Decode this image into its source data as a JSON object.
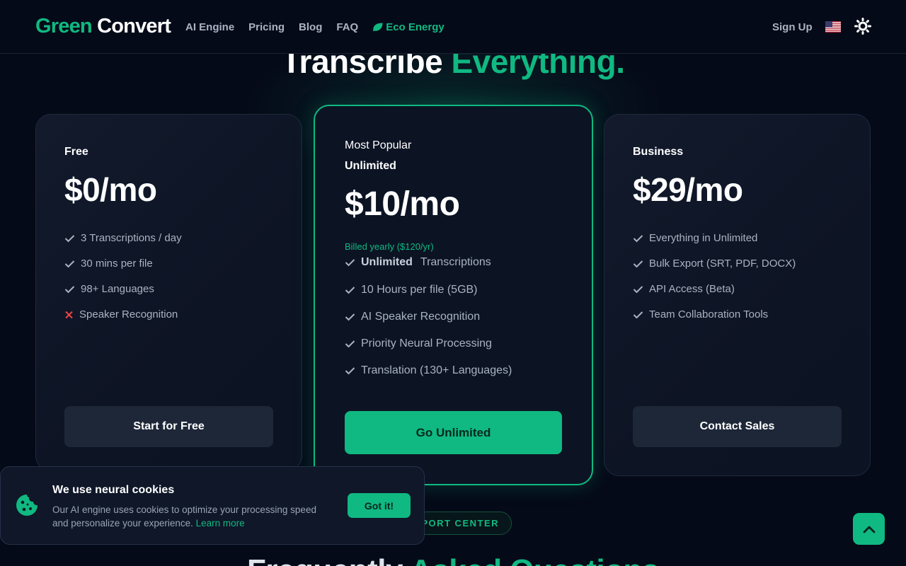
{
  "nav": {
    "logo_part1": "Green",
    "logo_part2": "Convert",
    "links": [
      "AI Engine",
      "Pricing",
      "Blog",
      "FAQ"
    ],
    "eco_label": "Eco Energy",
    "signup": "Sign Up"
  },
  "hero": {
    "title_part1": "Transcribe",
    "title_part2": "Everything."
  },
  "plans": {
    "free": {
      "name": "Free",
      "price": "$0/mo",
      "features": [
        {
          "text": "3 Transcriptions / day",
          "included": true
        },
        {
          "text": "30 mins per file",
          "included": true
        },
        {
          "text": "98+ Languages",
          "included": true
        },
        {
          "text": "Speaker Recognition",
          "included": false
        }
      ],
      "button": "Start for Free"
    },
    "unlimited": {
      "badge": "Most Popular",
      "name": "Unlimited",
      "price": "$10/mo",
      "billed": "Billed yearly ($120/yr)",
      "feature0_strong": "Unlimited",
      "feature0_rest": "Transcriptions",
      "features": [
        "10 Hours per file (5GB)",
        "AI Speaker Recognition",
        "Priority Neural Processing",
        "Translation (130+ Languages)"
      ],
      "button": "Go Unlimited"
    },
    "business": {
      "name": "Business",
      "price": "$29/mo",
      "features": [
        "Everything in Unlimited",
        "Bulk Export (SRT, PDF, DOCX)",
        "API Access (Beta)",
        "Team Collaboration Tools"
      ],
      "button": "Contact Sales"
    }
  },
  "cookie": {
    "title": "We use neural cookies",
    "text": "Our AI engine uses cookies to optimize your processing speed and personalize your experience.",
    "learn_more": "Learn more",
    "button": "Got it!"
  },
  "support": {
    "label": "PPORT CENTER"
  },
  "faq": {
    "title_part1": "Frequently",
    "title_part2": "Asked Questions"
  },
  "colors": {
    "accent": "#10b981",
    "background": "#050a18",
    "card": "#0d1424",
    "muted_text": "#aab3c2",
    "cross": "#ef4444"
  },
  "icons": [
    "leaf-icon",
    "us-flag-icon",
    "sun-icon",
    "check-icon",
    "cross-icon",
    "cookie-icon",
    "chevron-up-icon"
  ]
}
